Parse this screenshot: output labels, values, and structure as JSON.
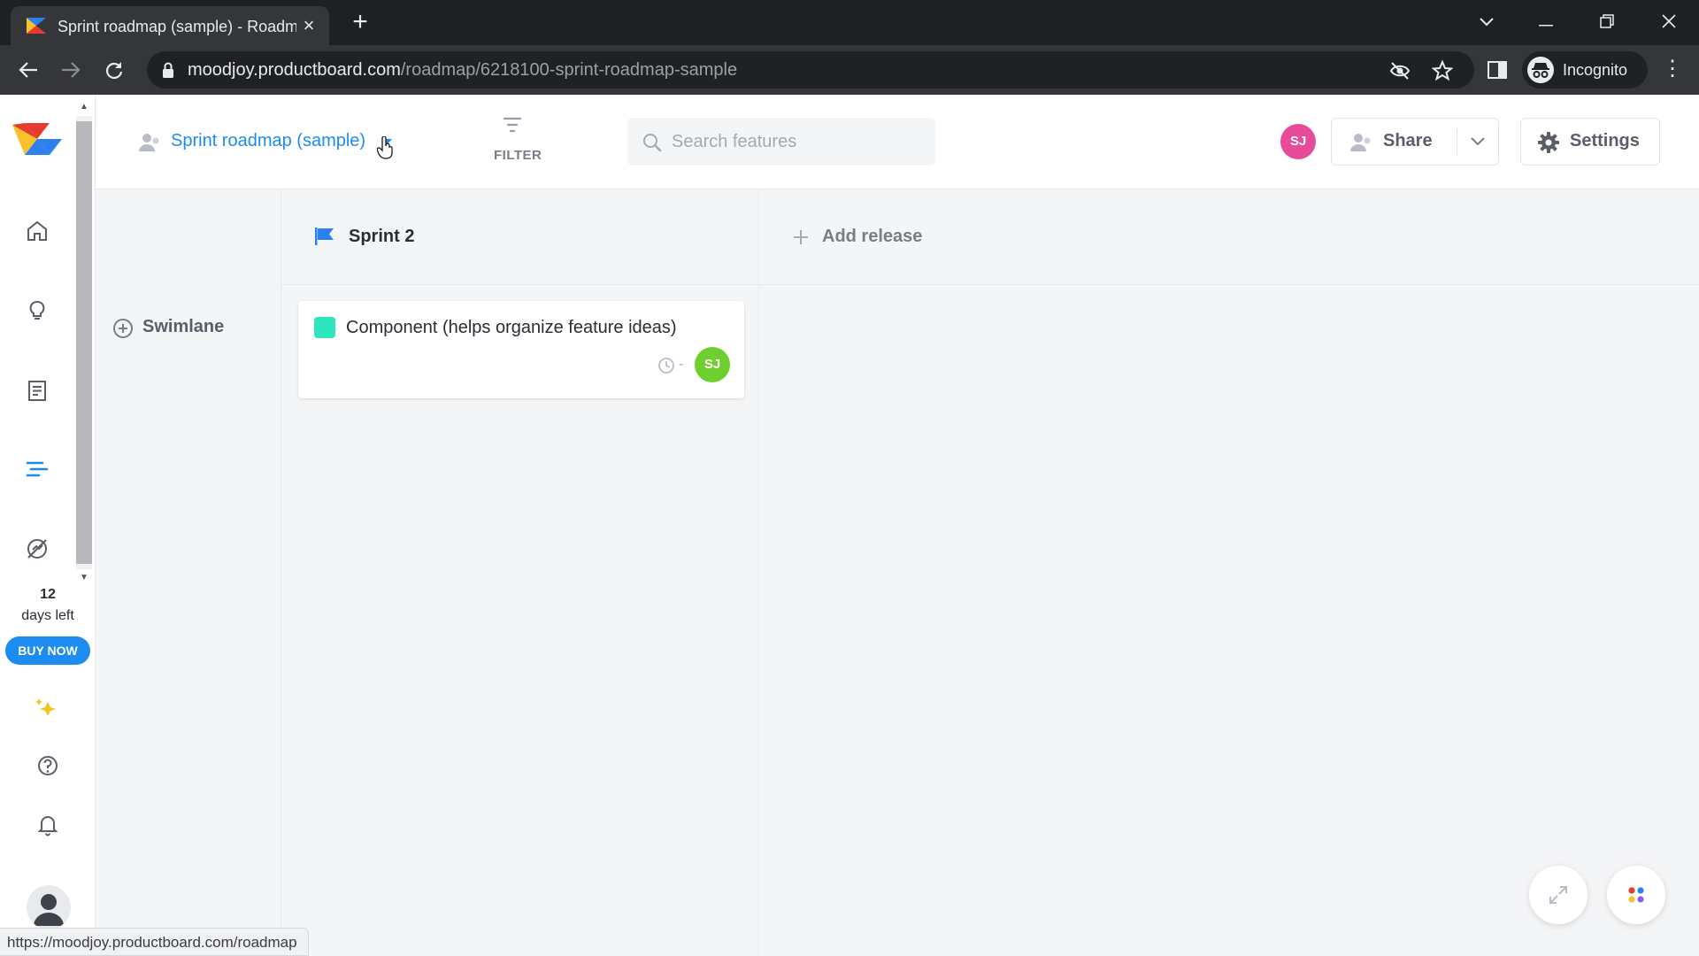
{
  "browser": {
    "tab_title": "Sprint roadmap (sample) - Roadmap",
    "url_host": "moodjoy.productboard.com",
    "url_path": "/roadmap/6218100-sprint-roadmap-sample",
    "profile_label": "Incognito",
    "status_url": "https://moodjoy.productboard.com/roadmap"
  },
  "rail": {
    "items": [
      "home-icon",
      "insights-icon",
      "notes-icon",
      "roadmap-icon",
      "portal-icon"
    ],
    "trial_days": "12",
    "trial_label": "days left",
    "buy_label": "BUY NOW"
  },
  "header": {
    "board_title": "Sprint roadmap (sample)",
    "filter_label": "FILTER",
    "search_placeholder": "Search features",
    "user_initials": "SJ",
    "share_label": "Share",
    "settings_label": "Settings"
  },
  "board": {
    "release_title": "Sprint 2",
    "add_release_label": "Add release",
    "swimlane_label": "Swimlane",
    "card": {
      "title": "Component (helps organize feature ideas)",
      "dash": "-",
      "assignee_initials": "SJ"
    }
  },
  "colors": {
    "accent": "#1d8cf0",
    "card_swatch": "#2ee6bd",
    "user_avatar": "#e84a9a",
    "card_avatar": "#6fcf2f"
  }
}
